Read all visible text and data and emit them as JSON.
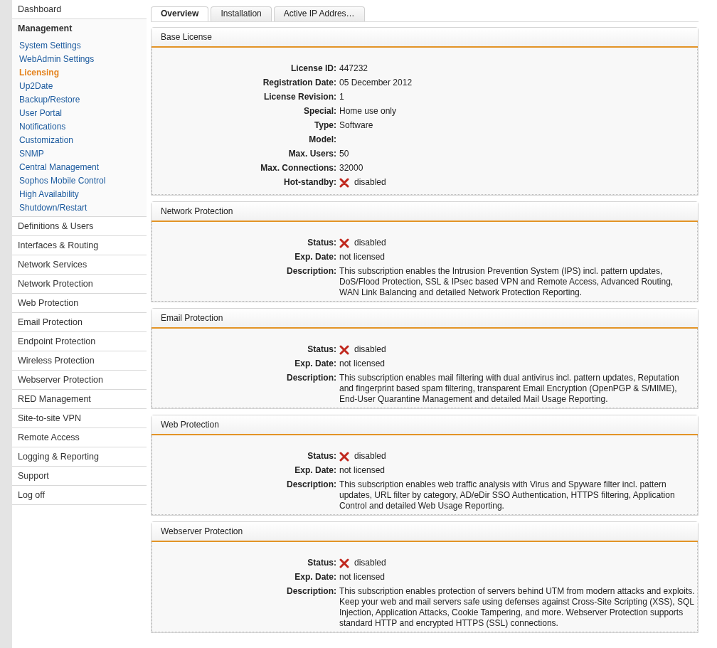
{
  "sidebar": {
    "items": [
      {
        "label": "Dashboard",
        "expanded": false
      },
      {
        "label": "Management",
        "expanded": true,
        "children": [
          {
            "label": "System Settings",
            "selected": false
          },
          {
            "label": "WebAdmin Settings",
            "selected": false
          },
          {
            "label": "Licensing",
            "selected": true
          },
          {
            "label": "Up2Date",
            "selected": false
          },
          {
            "label": "Backup/Restore",
            "selected": false
          },
          {
            "label": "User Portal",
            "selected": false
          },
          {
            "label": "Notifications",
            "selected": false
          },
          {
            "label": "Customization",
            "selected": false
          },
          {
            "label": "SNMP",
            "selected": false
          },
          {
            "label": "Central Management",
            "selected": false
          },
          {
            "label": "Sophos Mobile Control",
            "selected": false
          },
          {
            "label": "High Availability",
            "selected": false
          },
          {
            "label": "Shutdown/Restart",
            "selected": false
          }
        ]
      },
      {
        "label": "Definitions & Users",
        "expanded": false
      },
      {
        "label": "Interfaces & Routing",
        "expanded": false
      },
      {
        "label": "Network Services",
        "expanded": false
      },
      {
        "label": "Network Protection",
        "expanded": false
      },
      {
        "label": "Web Protection",
        "expanded": false
      },
      {
        "label": "Email Protection",
        "expanded": false
      },
      {
        "label": "Endpoint Protection",
        "expanded": false
      },
      {
        "label": "Wireless Protection",
        "expanded": false
      },
      {
        "label": "Webserver Protection",
        "expanded": false
      },
      {
        "label": "RED Management",
        "expanded": false
      },
      {
        "label": "Site-to-site VPN",
        "expanded": false
      },
      {
        "label": "Remote Access",
        "expanded": false
      },
      {
        "label": "Logging & Reporting",
        "expanded": false
      },
      {
        "label": "Support",
        "expanded": false
      },
      {
        "label": "Log off",
        "expanded": false
      }
    ]
  },
  "tabs": [
    {
      "label": "Overview",
      "selected": true
    },
    {
      "label": "Installation",
      "selected": false
    },
    {
      "label": "Active IP Addres…",
      "selected": false
    }
  ],
  "panels": [
    {
      "title": "Base License",
      "fields": [
        {
          "kind": "text",
          "label": "License ID:",
          "value": "447232"
        },
        {
          "kind": "text",
          "label": "Registration Date:",
          "value": "05 December 2012"
        },
        {
          "kind": "text",
          "label": "License Revision:",
          "value": "1"
        },
        {
          "kind": "text",
          "label": "Special:",
          "value": "Home use only"
        },
        {
          "kind": "text",
          "label": "Type:",
          "value": "Software"
        },
        {
          "kind": "text",
          "label": "Model:"
        },
        {
          "kind": "text",
          "label": "Max. Users:",
          "value": "50"
        },
        {
          "kind": "text",
          "label": "Max. Connections:",
          "value": "32000"
        },
        {
          "kind": "status",
          "label": "Hot-standby:",
          "value": "disabled",
          "enabled": false
        }
      ]
    },
    {
      "title": "Network Protection",
      "fields": [
        {
          "kind": "status",
          "label": "Status:",
          "value": "disabled",
          "enabled": false
        },
        {
          "kind": "text",
          "label": "Exp. Date:",
          "value": "not licensed"
        },
        {
          "kind": "text",
          "label": "Description:",
          "value": "This subscription enables the Intrusion Prevention System (IPS) incl. pattern updates, DoS/Flood Protection, SSL & IPsec based VPN and Remote Access, Advanced Routing, WAN Link Balancing and detailed Network Protection Reporting."
        }
      ]
    },
    {
      "title": "Email Protection",
      "fields": [
        {
          "kind": "status",
          "label": "Status:",
          "value": "disabled",
          "enabled": false
        },
        {
          "kind": "text",
          "label": "Exp. Date:",
          "value": "not licensed"
        },
        {
          "kind": "text",
          "label": "Description:",
          "value": "This subscription enables mail filtering with dual antivirus incl. pattern updates, Reputation and fingerprint based spam filtering, transparent Email Encryption (OpenPGP & S/MIME), End-User Quarantine Management and detailed Mail Usage Reporting."
        }
      ]
    },
    {
      "title": "Web Protection",
      "fields": [
        {
          "kind": "status",
          "label": "Status:",
          "value": "disabled",
          "enabled": false
        },
        {
          "kind": "text",
          "label": "Exp. Date:",
          "value": "not licensed"
        },
        {
          "kind": "text",
          "label": "Description:",
          "value": "This subscription enables web traffic analysis with Virus and Spyware filter incl. pattern updates, URL filter by category, AD/eDir SSO Authentication, HTTPS filtering, Application Control and detailed Web Usage Reporting."
        }
      ]
    },
    {
      "title": "Webserver Protection",
      "fields": [
        {
          "kind": "status",
          "label": "Status:",
          "value": "disabled",
          "enabled": false
        },
        {
          "kind": "text",
          "label": "Exp. Date:",
          "value": "not licensed"
        },
        {
          "kind": "text",
          "label": "Description:",
          "value": "This subscription enables protection of servers behind UTM from modern attacks and exploits. Keep your web and mail servers safe using defenses against Cross-Site Scripting (XSS), SQL Injection, Application Attacks, Cookie Tampering, and more. Webserver Protection supports standard HTTP and encrypted HTTPS (SSL) connections."
        }
      ]
    }
  ]
}
